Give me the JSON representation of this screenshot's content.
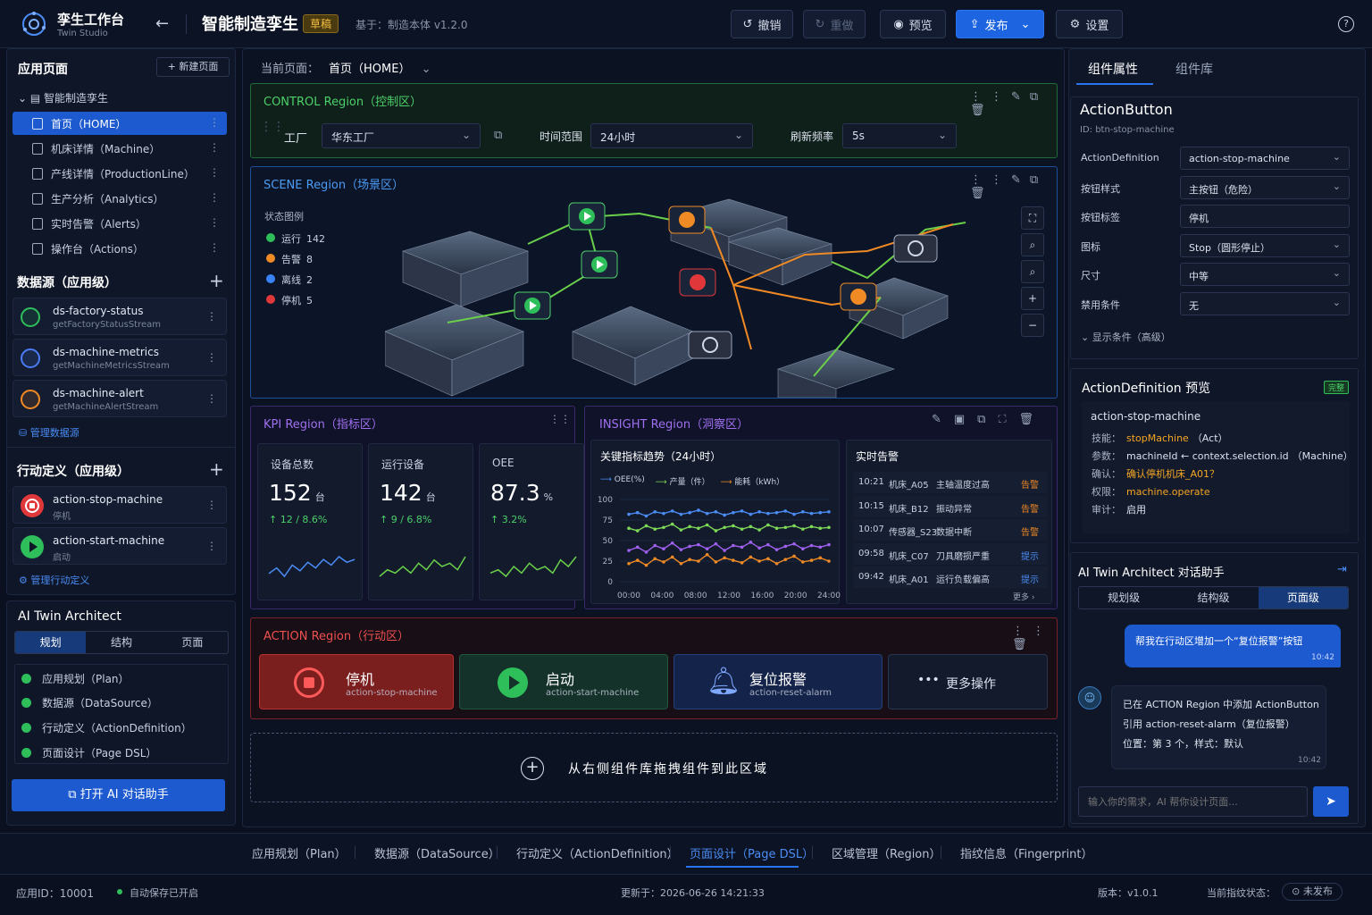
{
  "app": {
    "name": "孪生工作台",
    "sub": "Twin Studio",
    "back": "←",
    "title": "智能制造孪生",
    "badge": "草稿",
    "based_on": "基于：制造本体 v1.2.0"
  },
  "toolbar": {
    "undo": "撤销",
    "redo": "重做",
    "preview": "预览",
    "publish": "发布",
    "settings": "设置",
    "help": "?"
  },
  "left": {
    "pages_title": "应用页面",
    "new_page": "+ 新建页面",
    "root": "智能制造孪生",
    "pages": [
      {
        "label": "首页（HOME）"
      },
      {
        "label": "机床详情（Machine）"
      },
      {
        "label": "产线详情（ProductionLine）"
      },
      {
        "label": "生产分析（Analytics）"
      },
      {
        "label": "实时告警（Alerts）"
      },
      {
        "label": "操作台（Actions）"
      }
    ],
    "ds_title": "数据源（应用级）",
    "datasources": [
      {
        "name": "ds-factory-status",
        "stream": "getFactoryStatusStream",
        "color": "#2fbf5a"
      },
      {
        "name": "ds-machine-metrics",
        "stream": "getMachineMetricsStream",
        "color": "#4b7cf5"
      },
      {
        "name": "ds-machine-alert",
        "stream": "getMachineAlertStream",
        "color": "#f08a24"
      }
    ],
    "manage_ds": "管理数据源",
    "act_title": "行动定义（应用级）",
    "actions": [
      {
        "name": "action-stop-machine",
        "label": "停机"
      },
      {
        "name": "action-start-machine",
        "label": "启动"
      }
    ],
    "manage_act": "管理行动定义",
    "ai_title": "AI Twin Architect",
    "ai_tabs": [
      "规划",
      "结构",
      "页面"
    ],
    "checks": [
      "应用规划（Plan）",
      "数据源（DataSource）",
      "行动定义（ActionDefinition）",
      "页面设计（Page DSL）"
    ],
    "open_ai": "打开 AI 对话助手"
  },
  "canvas": {
    "current_label": "当前页面：",
    "current_page": "首页（HOME）",
    "control": {
      "title": "CONTROL Region（控制区）",
      "factory_label": "工厂",
      "factory": "华东工厂",
      "range_label": "时间范围",
      "range": "24小时",
      "refresh_label": "刷新频率",
      "refresh": "5s"
    },
    "scene": {
      "title": "SCENE Region（场景区）",
      "legend_title": "状态图例",
      "legend": [
        {
          "label": "运行",
          "count": "142",
          "color": "#2fbf5a"
        },
        {
          "label": "告警",
          "count": "8",
          "color": "#f08a24"
        },
        {
          "label": "离线",
          "count": "2",
          "color": "#3b82f6"
        },
        {
          "label": "停机",
          "count": "5",
          "color": "#e0383a"
        }
      ]
    },
    "kpi": {
      "title": "KPI Region（指标区）",
      "cards": [
        {
          "label": "设备总数",
          "value": "152",
          "unit": "台",
          "delta": "↑ 12 / 8.6%",
          "spark": [
            3,
            5,
            2,
            6,
            4,
            7,
            5,
            8,
            6,
            9,
            7,
            8
          ]
        },
        {
          "label": "运行设备",
          "value": "142",
          "unit": "台",
          "delta": "↑ 9 / 6.8%",
          "spark": [
            2,
            4,
            3,
            5,
            3,
            6,
            4,
            7,
            5,
            6,
            4,
            8
          ]
        },
        {
          "label": "OEE",
          "value": "87.3",
          "unit": "%",
          "delta": "↑ 3.2%",
          "spark": [
            3,
            4,
            2,
            5,
            3,
            6,
            4,
            5,
            3,
            7,
            5,
            8
          ]
        }
      ]
    },
    "insight": {
      "title": "INSIGHT Region（洞察区）",
      "trend_title": "关键指标趋势（24小时）",
      "alerts_title": "实时告警",
      "more": "更多 ›",
      "alerts": [
        {
          "time": "10:21",
          "machine": "机床_A05",
          "msg": "主轴温度过高",
          "level": "告警",
          "color": "#f08a24"
        },
        {
          "time": "10:15",
          "machine": "机床_B12",
          "msg": "振动异常",
          "level": "告警",
          "color": "#f08a24"
        },
        {
          "time": "10:07",
          "machine": "传感器_S23",
          "msg": "数据中断",
          "level": "告警",
          "color": "#f08a24"
        },
        {
          "time": "09:58",
          "machine": "机床_C07",
          "msg": "刀具磨损严重",
          "level": "提示",
          "color": "#4b8cf5"
        },
        {
          "time": "09:42",
          "machine": "机床_A01",
          "msg": "运行负载偏高",
          "level": "提示",
          "color": "#4b8cf5"
        }
      ]
    },
    "action": {
      "title": "ACTION Region（行动区）",
      "buttons": [
        {
          "label": "停机",
          "id": "action-stop-machine"
        },
        {
          "label": "启动",
          "id": "action-start-machine"
        },
        {
          "label": "复位报警",
          "id": "action-reset-alarm"
        }
      ],
      "more": "更多操作"
    },
    "drop": "从右侧组件库拖拽组件到此区域"
  },
  "chart_data": {
    "type": "line",
    "title": "关键指标趋势（24小时）",
    "xlabel": "",
    "ylabel": "",
    "ylim": [
      0,
      100
    ],
    "x": [
      "00:00",
      "04:00",
      "08:00",
      "12:00",
      "16:00",
      "20:00",
      "24:00"
    ],
    "yticks": [
      0,
      25,
      50,
      75,
      100
    ],
    "legend": [
      "OEE(%)",
      "产量（件）",
      "能耗（kWh）"
    ],
    "series": [
      {
        "name": "OEE(%)",
        "color": "#4b8cf5",
        "values": [
          82,
          84,
          80,
          85,
          83,
          86,
          82,
          84,
          87,
          83,
          85,
          81,
          84,
          86,
          82,
          85,
          83,
          84,
          86,
          82,
          85,
          83,
          84,
          85
        ]
      },
      {
        "name": "产量（件）",
        "color": "#7ed957",
        "values": [
          65,
          62,
          68,
          64,
          66,
          70,
          63,
          67,
          65,
          69,
          62,
          66,
          68,
          64,
          67,
          63,
          69,
          65,
          66,
          68,
          64,
          67,
          65,
          66
        ]
      },
      {
        "name": "能耗（kWh）",
        "color": "#f08a24",
        "values": [
          22,
          26,
          20,
          28,
          24,
          30,
          22,
          27,
          25,
          33,
          24,
          29,
          26,
          23,
          30,
          25,
          28,
          22,
          27,
          31,
          24,
          26,
          29,
          25
        ]
      },
      {
        "name": "",
        "color": "#a060f0",
        "values": [
          38,
          42,
          36,
          44,
          40,
          47,
          39,
          43,
          45,
          40,
          46,
          38,
          44,
          42,
          48,
          41,
          45,
          39,
          43,
          46,
          40,
          44,
          42,
          45
        ]
      }
    ]
  },
  "right": {
    "tab_props": "组件属性",
    "tab_lib": "组件库",
    "comp_name": "ActionButton",
    "comp_id": "ID: btn-stop-machine",
    "props": [
      {
        "label": "ActionDefinition",
        "value": "action-stop-machine",
        "select": true
      },
      {
        "label": "按钮样式",
        "value": "主按钮（危险）",
        "select": true
      },
      {
        "label": "按钮标签",
        "value": "停机",
        "select": false
      },
      {
        "label": "图标",
        "value": "Stop（圆形停止）",
        "select": true
      },
      {
        "label": "尺寸",
        "value": "中等",
        "select": true
      },
      {
        "label": "禁用条件",
        "value": "无",
        "select": true
      }
    ],
    "show_cond": "显示条件（高级）",
    "preview_title": "ActionDefinition 预览",
    "complete": "完整",
    "preview": {
      "name": "action-stop-machine",
      "rows": [
        {
          "k": "技能：",
          "v": "stopMachine",
          "v2": "（Act）"
        },
        {
          "k": "参数：",
          "v": "machineId ← context.selection.id",
          "v2": "（Machine）"
        },
        {
          "k": "确认：",
          "v": "确认停机机床_A01？",
          "v2": ""
        },
        {
          "k": "权限：",
          "v": "machine.operate",
          "v2": ""
        },
        {
          "k": "审计：",
          "v": "启用",
          "v2": ""
        }
      ]
    },
    "ai_title": "AI Twin Architect 对话助手",
    "ai_tabs": [
      "规划级",
      "结构级",
      "页面级"
    ],
    "user_msg": "帮我在行动区增加一个“复位报警”按钮",
    "user_time": "10:42",
    "bot_lines": [
      "已在 ACTION Region 中添加 ActionButton",
      "引用 action-reset-alarm（复位报警）",
      "位置：第 3 个，样式：默认"
    ],
    "bot_time": "10:42",
    "input_placeholder": "输入你的需求，AI 帮你设计页面..."
  },
  "bottom_tabs": [
    "应用规划（Plan）",
    "数据源（DataSource）",
    "行动定义（ActionDefinition）",
    "页面设计（Page DSL）",
    "区域管理（Region）",
    "指纹信息（Fingerprint）"
  ],
  "footer": {
    "app_id": "应用ID：10001",
    "autosave": "自动保存已开启",
    "updated": "更新于：2026-06-26 14:21:33",
    "version": "版本：v1.0.1",
    "fp_label": "当前指纹状态：",
    "fp_status": "未发布"
  },
  "colors": {
    "accent": "#1d64e0",
    "control": "#2fbf5a",
    "scene": "#3b82f6",
    "kpi": "#a060f0",
    "action": "#e0383a"
  }
}
